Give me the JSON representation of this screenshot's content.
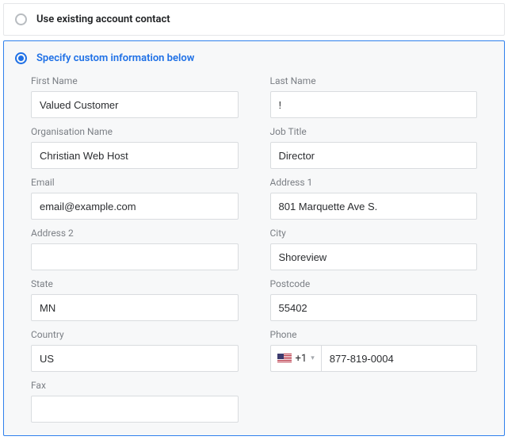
{
  "options": {
    "existing_label": "Use existing account contact",
    "custom_label": "Specify custom information below"
  },
  "fields": {
    "first_name": {
      "label": "First Name",
      "value": "Valued Customer"
    },
    "last_name": {
      "label": "Last Name",
      "value": "!"
    },
    "org": {
      "label": "Organisation Name",
      "value": "Christian Web Host"
    },
    "job": {
      "label": "Job Title",
      "value": "Director"
    },
    "email": {
      "label": "Email",
      "value": "email@example.com"
    },
    "addr1": {
      "label": "Address 1",
      "value": "801 Marquette Ave S."
    },
    "addr2": {
      "label": "Address 2",
      "value": ""
    },
    "city": {
      "label": "City",
      "value": "Shoreview"
    },
    "state": {
      "label": "State",
      "value": "MN"
    },
    "postcode": {
      "label": "Postcode",
      "value": "55402"
    },
    "country": {
      "label": "Country",
      "value": "US"
    },
    "phone": {
      "label": "Phone",
      "prefix": "+1",
      "value": "877-819-0004"
    },
    "fax": {
      "label": "Fax",
      "value": ""
    }
  }
}
